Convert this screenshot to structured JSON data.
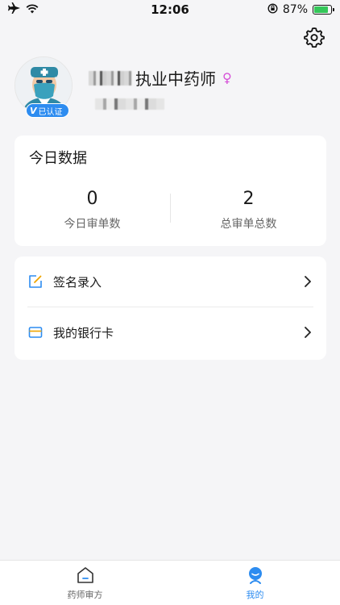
{
  "status_bar": {
    "time": "12:06",
    "battery": "87%",
    "battery_level": 0.87
  },
  "profile": {
    "title": "执业中药师",
    "gender_symbol": "♀",
    "verified_label": "已认证",
    "verified_mark": "V"
  },
  "stats": {
    "title": "今日数据",
    "items": [
      {
        "value": "0",
        "label": "今日审单数"
      },
      {
        "value": "2",
        "label": "总审单总数"
      }
    ]
  },
  "menu": {
    "items": [
      {
        "label": "签名录入",
        "icon": "edit-icon"
      },
      {
        "label": "我的银行卡",
        "icon": "bank-card-icon"
      }
    ]
  },
  "tabs": [
    {
      "label": "药师审方",
      "icon": "home-icon",
      "active": false
    },
    {
      "label": "我的",
      "icon": "profile-icon",
      "active": true
    }
  ],
  "colors": {
    "accent": "#2d8cf0",
    "gender": "#d64fd8",
    "battery": "#34c759",
    "edit_icon": "#f0a500"
  }
}
